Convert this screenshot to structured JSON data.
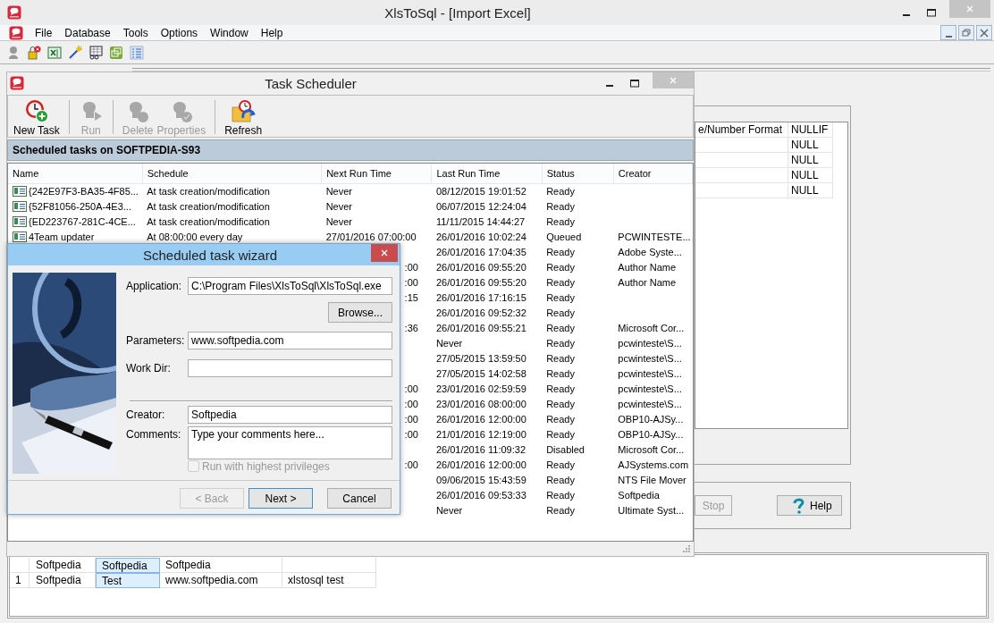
{
  "window": {
    "title": "XlsToSql - [Import Excel]"
  },
  "menu": [
    {
      "label": "File"
    },
    {
      "label": "Database"
    },
    {
      "label": "Tools"
    },
    {
      "label": "Options"
    },
    {
      "label": "Window"
    },
    {
      "label": "Help"
    }
  ],
  "import_excel": {
    "columns": [
      "e/Number Format",
      "NULLIF"
    ],
    "rows": [
      {
        "nullif": "NULL"
      },
      {
        "nullif": "NULL"
      },
      {
        "nullif": "NULL"
      },
      {
        "nullif": "NULL"
      }
    ],
    "buttons": [
      {
        "kind": "stop",
        "label": "Stop",
        "disabled": true
      },
      {
        "kind": "help",
        "label": "Help",
        "disabled": false
      }
    ]
  },
  "data_grid": {
    "rows": [
      {
        "cells": [
          {
            "text": "Softpedia",
            "selected": false
          },
          {
            "text": "Softpedia",
            "selected": true
          },
          {
            "text": "Softpedia",
            "selected": false
          },
          {
            "selected": false
          }
        ]
      },
      {
        "header": "1",
        "cells": [
          {
            "text": "Softpedia",
            "selected": false
          },
          {
            "text": "Test",
            "selected": true
          },
          {
            "text": "www.softpedia.com",
            "selected": false
          },
          {
            "text": "xlstosql test",
            "selected": false
          }
        ]
      }
    ]
  },
  "task_scheduler": {
    "title": "Task Scheduler",
    "toolbar": [
      {
        "kind": "new",
        "label": "New Task",
        "disabled": false
      },
      {
        "kind": "run",
        "label": "Run",
        "disabled": true
      },
      {
        "kind": "delete",
        "label": "Delete",
        "disabled": true
      },
      {
        "kind": "properties",
        "label": "Properties",
        "disabled": true
      },
      {
        "kind": "refresh",
        "label": "Refresh",
        "disabled": false
      }
    ],
    "header": "Scheduled tasks on SOFTPEDIA-S93",
    "columns": [
      "Name",
      "Schedule",
      "Next Run Time",
      "Last Run Time",
      "Status",
      "Creator"
    ],
    "rows": [
      {
        "name": "{242E97F3-BA35-4F85...",
        "schedule": "At task creation/modification",
        "next_run": "Never",
        "last_run": "08/12/2015 19:01:52",
        "status": "Ready"
      },
      {
        "name": "{52F81056-250A-4E3...",
        "schedule": "At task creation/modification",
        "next_run": "Never",
        "last_run": "06/07/2015 12:24:04",
        "status": "Ready"
      },
      {
        "name": "{ED223767-281C-4CE...",
        "schedule": "At task creation/modification",
        "next_run": "Never",
        "last_run": "11/11/2015 14:44:27",
        "status": "Ready"
      },
      {
        "name": "4Team updater",
        "schedule": "At 08:00:00 every day",
        "next_run": "27/01/2016 07:00:00",
        "last_run": "26/01/2016 10:02:24",
        "status": "Queued",
        "creator": "PCWINTESTE..."
      },
      {
        "last_run": "26/01/2016 17:04:35",
        "status": "Ready",
        "creator": "Adobe Syste..."
      },
      {
        "next_run": ":00",
        "last_run": "26/01/2016 09:55:20",
        "status": "Ready",
        "creator": "Author Name"
      },
      {
        "next_run": ":00",
        "last_run": "26/01/2016 09:55:20",
        "status": "Ready",
        "creator": "Author Name"
      },
      {
        "next_run": ":15",
        "last_run": "26/01/2016 17:16:15",
        "status": "Ready"
      },
      {
        "last_run": "26/01/2016 09:52:32",
        "status": "Ready"
      },
      {
        "next_run": ":36",
        "last_run": "26/01/2016 09:55:21",
        "status": "Ready",
        "creator": "Microsoft Cor..."
      },
      {
        "last_run": "Never",
        "status": "Ready",
        "creator": "pcwinteste\\S..."
      },
      {
        "last_run": "27/05/2015 13:59:50",
        "status": "Ready",
        "creator": "pcwinteste\\S..."
      },
      {
        "last_run": "27/05/2015 14:02:58",
        "status": "Ready",
        "creator": "pcwinteste\\S..."
      },
      {
        "next_run": ":00",
        "last_run": "23/01/2016 02:59:59",
        "status": "Ready",
        "creator": "pcwinteste\\S..."
      },
      {
        "next_run": ":00",
        "last_run": "23/01/2016 08:00:00",
        "status": "Ready",
        "creator": "pcwinteste\\S..."
      },
      {
        "next_run": ":00",
        "last_run": "26/01/2016 12:00:00",
        "status": "Ready",
        "creator": "OBP10-AJSy..."
      },
      {
        "next_run": ":00",
        "last_run": "21/01/2016 12:19:00",
        "status": "Ready",
        "creator": "OBP10-AJSy..."
      },
      {
        "last_run": "26/01/2016 11:09:32",
        "status": "Disabled",
        "creator": "Microsoft Cor..."
      },
      {
        "next_run": ":00",
        "last_run": "26/01/2016 12:00:00",
        "status": "Ready",
        "creator": "AJSystems.com"
      },
      {
        "last_run": "09/06/2015 15:43:59",
        "status": "Ready",
        "creator": "NTS File Mover"
      },
      {
        "last_run": "26/01/2016 09:53:33",
        "status": "Ready",
        "creator": "Softpedia"
      },
      {
        "last_run": "Never",
        "status": "Ready",
        "creator": "Ultimate Syst..."
      }
    ]
  },
  "wizard": {
    "title": "Scheduled task wizard",
    "application": {
      "label": "Application:",
      "value": "C:\\Program Files\\XlsToSql\\XlsToSql.exe"
    },
    "browse_button": "Browse...",
    "parameters": {
      "label": "Parameters:",
      "value": "www.softpedia.com"
    },
    "work_dir": {
      "label": "Work Dir:"
    },
    "creator": {
      "label": "Creator:",
      "value": "Softpedia"
    },
    "comments": {
      "label": "Comments:",
      "value": "Type your comments here..."
    },
    "checkbox": {
      "label": "Run with highest privileges",
      "checked": false,
      "disabled": true
    },
    "buttons": [
      {
        "label": "< Back",
        "disabled": true,
        "default": false
      },
      {
        "label": "Next >",
        "disabled": false,
        "default": true
      },
      {
        "label": "Cancel",
        "disabled": false,
        "default": false
      }
    ]
  }
}
